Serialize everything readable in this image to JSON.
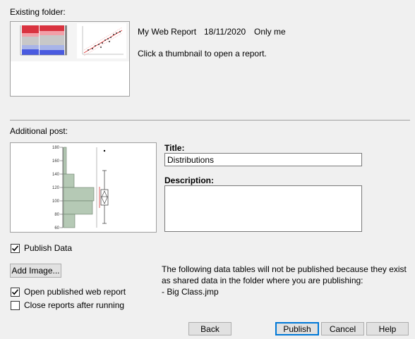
{
  "existing": {
    "section_label": "Existing folder:",
    "report_name": "My Web Report",
    "date": "18/11/2020",
    "access": "Only me",
    "hint": "Click a thumbnail to open a report."
  },
  "additional": {
    "section_label": "Additional post:",
    "histogram_ticks": [
      "180",
      "160",
      "140",
      "120",
      "100",
      "80",
      "60"
    ],
    "title_label": "Title:",
    "title_value": "Distributions",
    "description_label": "Description:",
    "description_value": ""
  },
  "options": {
    "publish_data_label": "Publish Data",
    "publish_data_checked": true,
    "add_image_label": "Add Image...",
    "open_report_label": "Open published web report",
    "open_report_checked": true,
    "close_reports_label": "Close reports after running",
    "close_reports_checked": false
  },
  "notice": {
    "line1": "The following data tables will not be published because they exist",
    "line2": "as shared data in the folder where you are publishing:",
    "table": "- Big Class.jmp"
  },
  "buttons": {
    "back": "Back",
    "publish": "Publish",
    "cancel": "Cancel",
    "help": "Help"
  },
  "colors": {
    "accent": "#0078d7",
    "histogram_fill": "#b5c9b5"
  }
}
